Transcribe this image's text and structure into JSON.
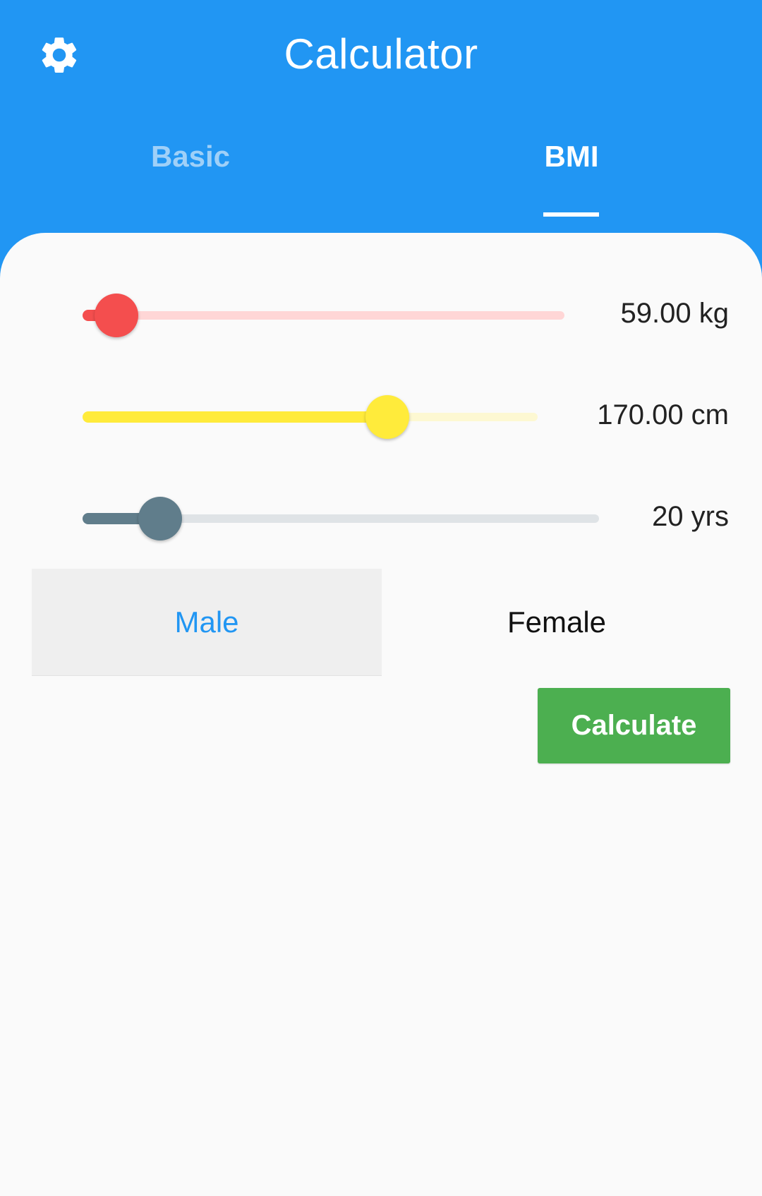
{
  "appbar": {
    "title": "Calculator",
    "settings_icon": "gear-icon",
    "color": "#2196f3"
  },
  "tabs": [
    {
      "label": "Basic",
      "selected": false
    },
    {
      "label": "BMI",
      "selected": true
    }
  ],
  "sliders": [
    {
      "name": "weight",
      "value_text": "59.00 kg",
      "fraction": 0.07,
      "color": "#f44e4e",
      "track_color": "#ffd6d6"
    },
    {
      "name": "height",
      "value_text": "170.00 cm",
      "fraction": 0.67,
      "color": "#ffeb3b",
      "track_color": "#fdf8d2"
    },
    {
      "name": "age",
      "value_text": "20 yrs",
      "fraction": 0.15,
      "color": "#607d8b",
      "track_color": "#dfe3e6"
    }
  ],
  "gender": {
    "options": [
      "Male",
      "Female"
    ],
    "selected": "Male"
  },
  "calculate_button": {
    "label": "Calculate",
    "color": "#4caf50"
  }
}
